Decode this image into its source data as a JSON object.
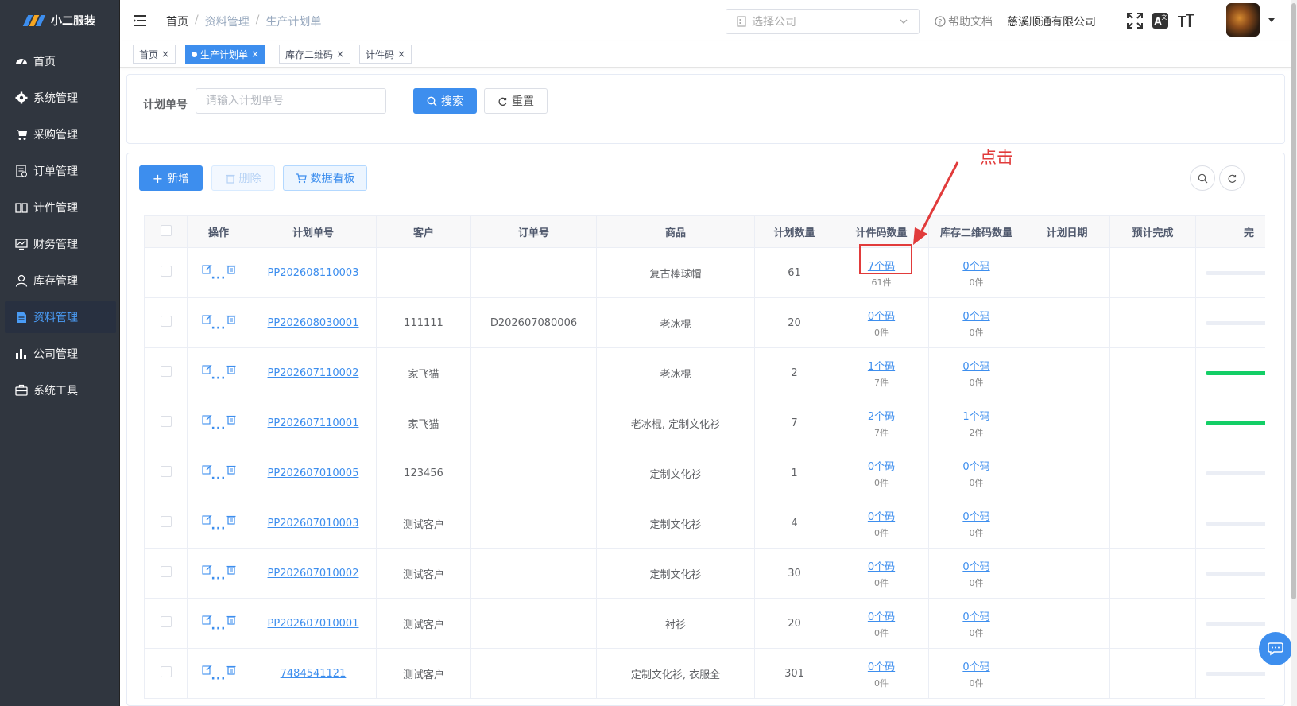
{
  "app": {
    "name": "小二服装",
    "brand_color": "#3d8eee",
    "sidebar_bg": "#30363f"
  },
  "sidebar": {
    "items": [
      {
        "label": "首页",
        "icon": "dashboard-icon"
      },
      {
        "label": "系统管理",
        "icon": "gear-icon"
      },
      {
        "label": "采购管理",
        "icon": "cart-icon"
      },
      {
        "label": "订单管理",
        "icon": "order-icon"
      },
      {
        "label": "计件管理",
        "icon": "book-icon"
      },
      {
        "label": "财务管理",
        "icon": "finance-icon"
      },
      {
        "label": "库存管理",
        "icon": "user-icon"
      },
      {
        "label": "资料管理",
        "icon": "document-icon",
        "active": true
      },
      {
        "label": "公司管理",
        "icon": "bar-chart-icon"
      },
      {
        "label": "系统工具",
        "icon": "toolbox-icon"
      }
    ]
  },
  "header": {
    "breadcrumb": [
      "首页",
      "资料管理",
      "生产计划单"
    ],
    "breadcrumb_sep": "/",
    "company_select_placeholder": "选择公司",
    "help_label": "帮助文档",
    "company_name": "慈溪顺通有限公司"
  },
  "tags": [
    {
      "label": "首页",
      "active": false
    },
    {
      "label": "生产计划单",
      "active": true
    },
    {
      "label": "库存二维码",
      "active": false
    },
    {
      "label": "计件码",
      "active": false
    }
  ],
  "search": {
    "label": "计划单号",
    "placeholder": "请输入计划单号",
    "value": "",
    "search_btn": "搜索",
    "reset_btn": "重置"
  },
  "toolbar": {
    "add": "新增",
    "delete": "删除",
    "dashboard": "数据看板"
  },
  "table": {
    "columns": [
      "操作",
      "计划单号",
      "客户",
      "订单号",
      "商品",
      "计划数量",
      "计件码数量",
      "库存二维码数量",
      "计划日期",
      "预计完成",
      "完"
    ],
    "rows": [
      {
        "plan_no": "PP202608110003",
        "customer": "",
        "order_no": "",
        "product": "复古棒球帽",
        "qty": "61",
        "piece_codes": "7个码",
        "piece_count": "61件",
        "stock_codes": "0个码",
        "stock_count": "0件",
        "plan_date": "",
        "eta": "",
        "progress": 0.0
      },
      {
        "plan_no": "PP202608030001",
        "customer": "111111",
        "order_no": "D202607080006",
        "product": "老冰棍",
        "qty": "20",
        "piece_codes": "0个码",
        "piece_count": "0件",
        "stock_codes": "0个码",
        "stock_count": "0件",
        "plan_date": "",
        "eta": "",
        "progress": 0.0
      },
      {
        "plan_no": "PP202607110002",
        "customer": "家飞猫",
        "order_no": "",
        "product": "老冰棍",
        "qty": "2",
        "piece_codes": "1个码",
        "piece_count": "7件",
        "stock_codes": "0个码",
        "stock_count": "0件",
        "plan_date": "",
        "eta": "",
        "progress": 1.0
      },
      {
        "plan_no": "PP202607110001",
        "customer": "家飞猫",
        "order_no": "",
        "product": "老冰棍, 定制文化衫",
        "qty": "7",
        "piece_codes": "2个码",
        "piece_count": "7件",
        "stock_codes": "1个码",
        "stock_count": "2件",
        "plan_date": "",
        "eta": "",
        "progress": 1.0
      },
      {
        "plan_no": "PP202607010005",
        "customer": "123456",
        "order_no": "",
        "product": "定制文化衫",
        "qty": "1",
        "piece_codes": "0个码",
        "piece_count": "0件",
        "stock_codes": "0个码",
        "stock_count": "0件",
        "plan_date": "",
        "eta": "",
        "progress": 0.0
      },
      {
        "plan_no": "PP202607010003",
        "customer": "测试客户",
        "order_no": "",
        "product": "定制文化衫",
        "qty": "4",
        "piece_codes": "0个码",
        "piece_count": "0件",
        "stock_codes": "0个码",
        "stock_count": "0件",
        "plan_date": "",
        "eta": "",
        "progress": 0.0
      },
      {
        "plan_no": "PP202607010002",
        "customer": "测试客户",
        "order_no": "",
        "product": "定制文化衫",
        "qty": "30",
        "piece_codes": "0个码",
        "piece_count": "0件",
        "stock_codes": "0个码",
        "stock_count": "0件",
        "plan_date": "",
        "eta": "",
        "progress": 0.0
      },
      {
        "plan_no": "PP202607010001",
        "customer": "测试客户",
        "order_no": "",
        "product": "衬衫",
        "qty": "20",
        "piece_codes": "0个码",
        "piece_count": "0件",
        "stock_codes": "0个码",
        "stock_count": "0件",
        "plan_date": "",
        "eta": "",
        "progress": 0.0
      },
      {
        "plan_no": "7484541121",
        "customer": "测试客户",
        "order_no": "",
        "product": "定制文化衫, 衣服全",
        "qty": "301",
        "piece_codes": "0个码",
        "piece_count": "0件",
        "stock_codes": "0个码",
        "stock_count": "0件",
        "plan_date": "",
        "eta": "",
        "progress": 0.0
      }
    ]
  },
  "annotation": {
    "text": "点击",
    "color": "#e13b3b"
  }
}
